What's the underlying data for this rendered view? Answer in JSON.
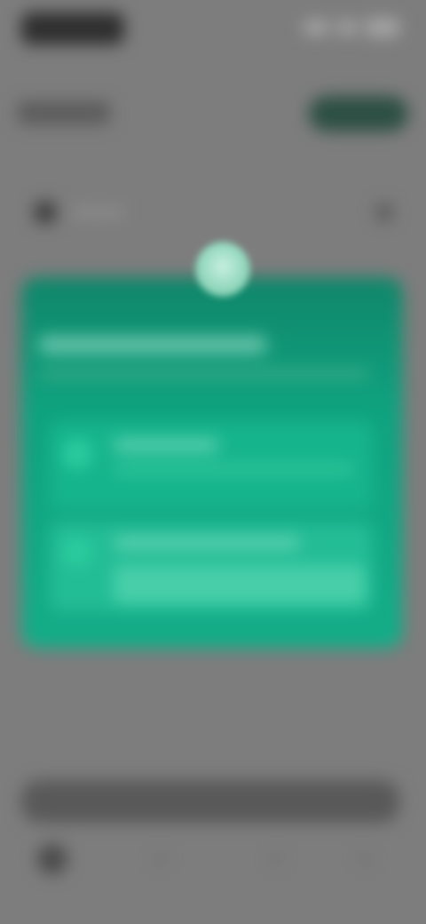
{
  "status_bar": {
    "time": "",
    "icons": [
      "signal-icon",
      "wifi-icon",
      "battery-icon"
    ]
  },
  "header": {
    "title": "",
    "action_label": ""
  },
  "nav": {
    "label": ""
  },
  "modal": {
    "title": "",
    "subtitle": "",
    "options": [
      {
        "title": "",
        "description": ""
      },
      {
        "title": "",
        "description": ""
      }
    ]
  },
  "bottom": {
    "search_placeholder": ""
  },
  "colors": {
    "accent": "#0fa27f",
    "card_top": "#10866a",
    "overlay": "#7d7d7d",
    "header_button": "#2d4f44"
  }
}
